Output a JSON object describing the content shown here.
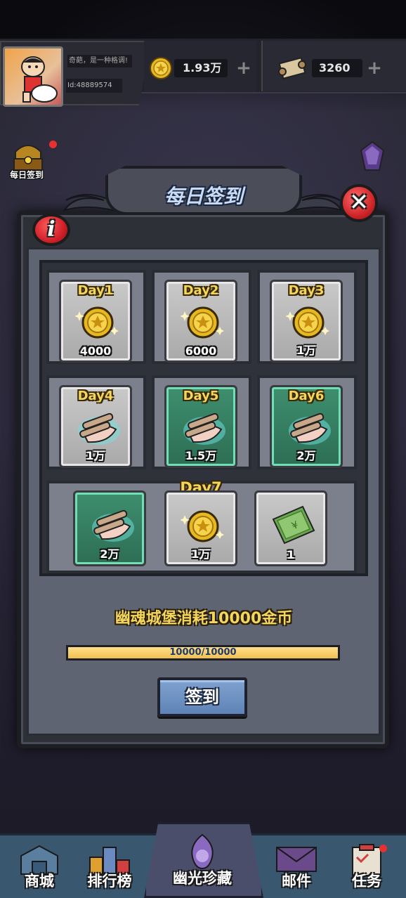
{
  "header": {
    "motto": "奇葩，是一种格调!",
    "user_id": "Id:48889574",
    "coins": "1.93万",
    "scrolls": "3260",
    "plus_symbol": "+"
  },
  "side": {
    "daily_checkin_label": "每日签到"
  },
  "modal": {
    "title": "每日签到",
    "close_symbol": "✕",
    "info_symbol": "i",
    "days": [
      {
        "label": "Day1",
        "amount": "4000",
        "reward": "coin",
        "state": "normal"
      },
      {
        "label": "Day2",
        "amount": "6000",
        "reward": "coin",
        "state": "normal"
      },
      {
        "label": "Day3",
        "amount": "1万",
        "reward": "coin",
        "state": "normal"
      },
      {
        "label": "Day4",
        "amount": "1万",
        "reward": "scroll",
        "state": "normal"
      },
      {
        "label": "Day5",
        "amount": "1.5万",
        "reward": "scroll",
        "state": "claimable"
      },
      {
        "label": "Day6",
        "amount": "2万",
        "reward": "scroll",
        "state": "claimable"
      }
    ],
    "day7": {
      "label": "Day7",
      "rewards": [
        {
          "amount": "2万",
          "reward": "scroll",
          "state": "claimable"
        },
        {
          "amount": "1万",
          "reward": "coin",
          "state": "normal"
        },
        {
          "amount": "1",
          "reward": "ticket",
          "state": "normal"
        }
      ]
    },
    "requirement": "幽魂城堡消耗10000金币",
    "progress_text": "10000/10000",
    "progress_fraction": 1.0,
    "sign_button": "签到"
  },
  "bottom_nav": {
    "shop": "商城",
    "ranking": "排行榜",
    "treasure": "幽光珍藏",
    "mail": "邮件",
    "tasks": "任务"
  },
  "colors": {
    "gold_text": "#f4d65c",
    "claimable_bg": "#3e8e6e",
    "sign_button": "#6f93c4",
    "close_red": "#d0262a"
  }
}
